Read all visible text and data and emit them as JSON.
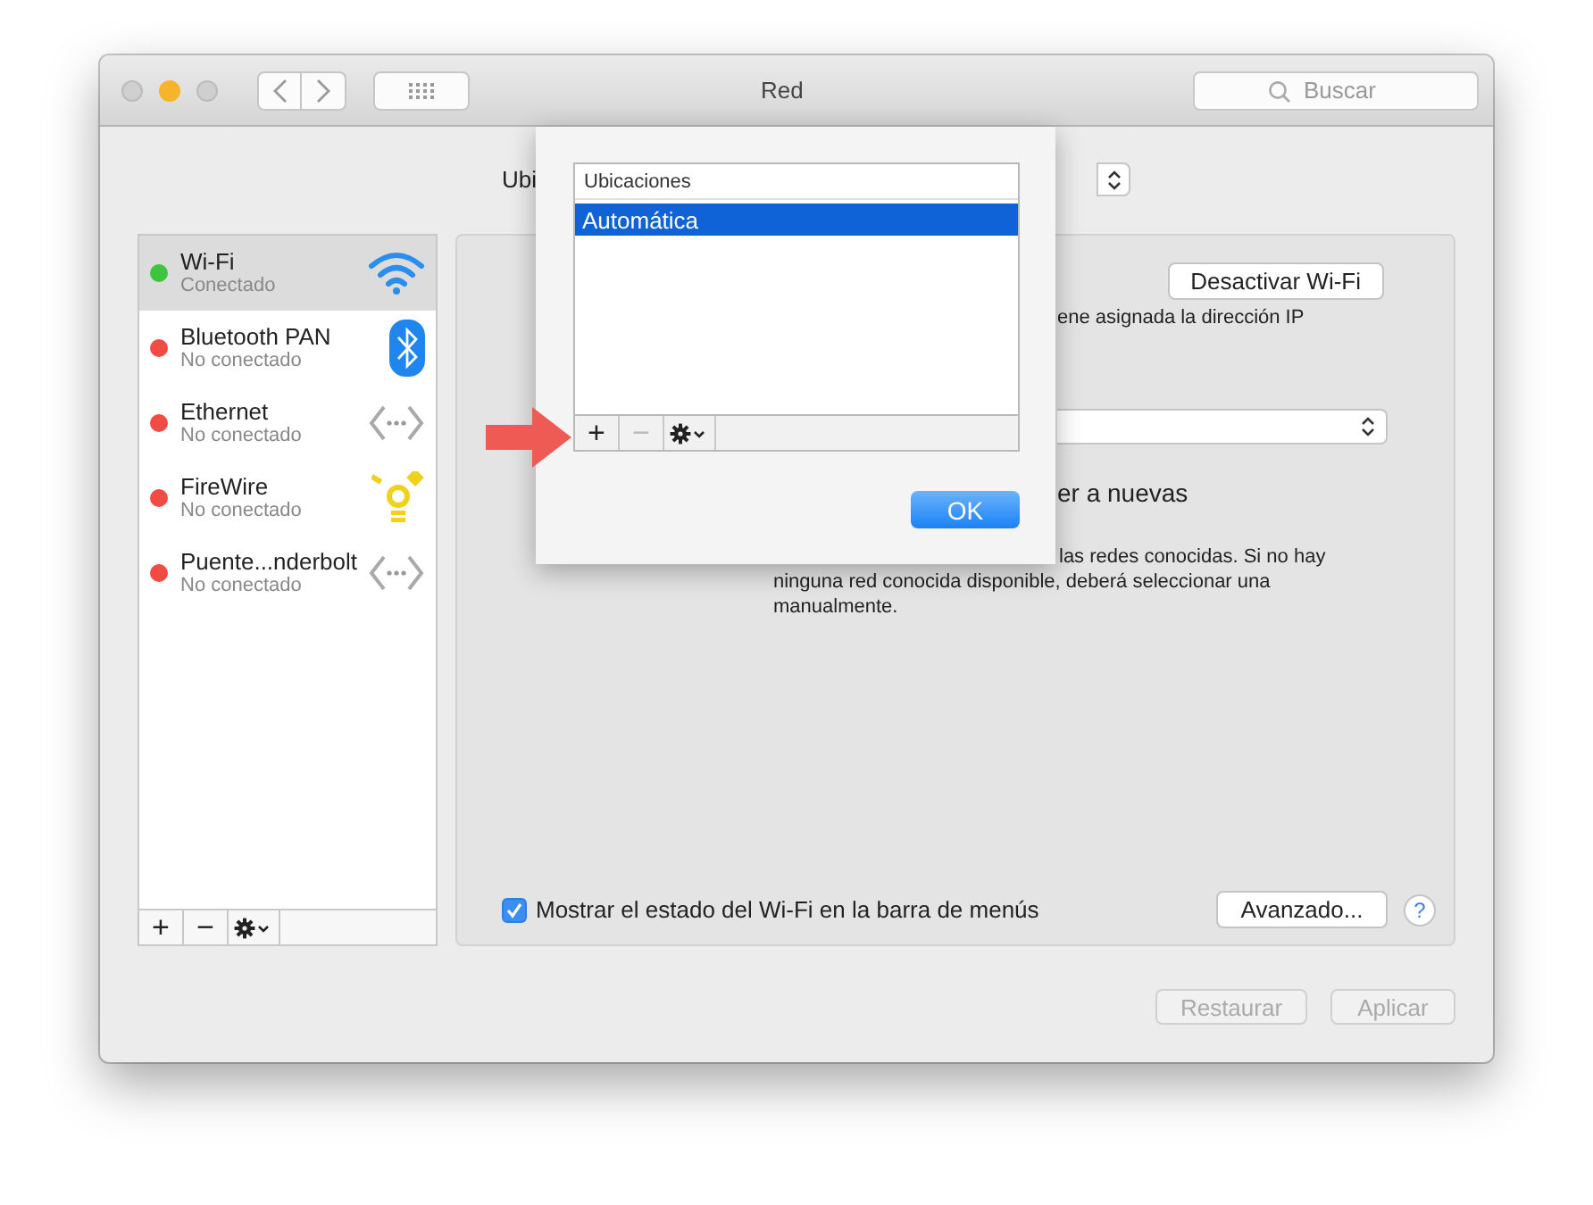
{
  "window": {
    "title": "Red",
    "search": {
      "placeholder": "Buscar"
    }
  },
  "location": {
    "label": "Ubi"
  },
  "services": [
    {
      "name": "Wi-Fi",
      "status": "Conectado",
      "color": "#3ec43e",
      "selected": true,
      "kind": "wifi"
    },
    {
      "name": "Bluetooth PAN",
      "status": "No conectado",
      "color": "#f24a45",
      "selected": false,
      "kind": "bluetooth"
    },
    {
      "name": "Ethernet",
      "status": "No conectado",
      "color": "#f24a45",
      "selected": false,
      "kind": "ethernet"
    },
    {
      "name": "FireWire",
      "status": "No conectado",
      "color": "#f24a45",
      "selected": false,
      "kind": "firewire"
    },
    {
      "name": "Puente...nderbolt",
      "status": "No conectado",
      "color": "#f24a45",
      "selected": false,
      "kind": "ethernet"
    }
  ],
  "service_toolbar": [
    {
      "label": "+",
      "disabled": false
    },
    {
      "label": "−",
      "disabled": false
    }
  ],
  "detail": {
    "toggle_button": "Desactivar Wi-Fi",
    "status_text": "ene asignada la dirección IP",
    "join_text": "er a nuevas",
    "note": "las redes conocidas. Si no hay ninguna red conocida disponible, deberá seleccionar una manualmente.",
    "show_status": {
      "label": "Mostrar el estado del Wi-Fi en la barra de menús",
      "checked": true
    },
    "advanced_button": "Avanzado...",
    "help": "?"
  },
  "footer_buttons": [
    {
      "label": "Restaurar",
      "disabled": true
    },
    {
      "label": "Aplicar",
      "disabled": true
    }
  ],
  "sheet": {
    "header": "Ubicaciones",
    "locations": [
      {
        "name": "Automática",
        "selected": true
      }
    ],
    "toolbar": [
      {
        "label": "+",
        "disabled": false
      },
      {
        "label": "−",
        "disabled": true
      }
    ],
    "ok_button": "OK"
  }
}
